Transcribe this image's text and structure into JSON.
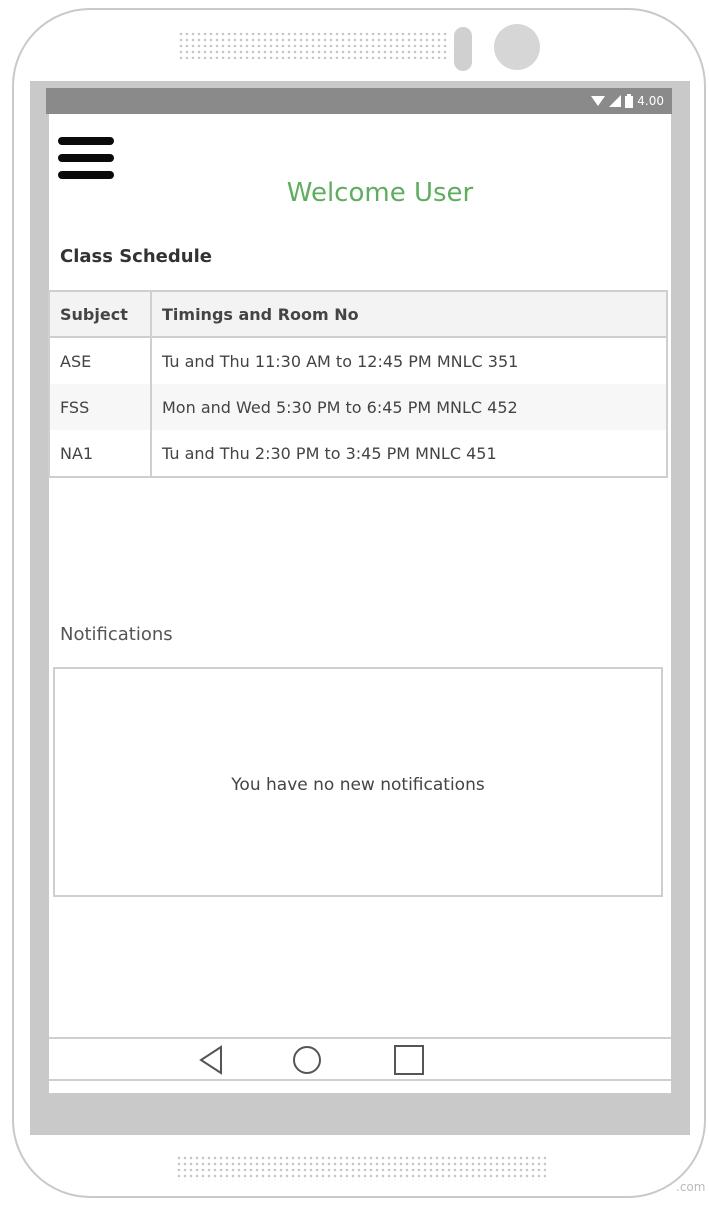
{
  "status_bar": {
    "time": "4.00"
  },
  "header": {
    "welcome": "Welcome User"
  },
  "schedule": {
    "title": "Class Schedule",
    "columns": [
      "Subject",
      "Timings and Room No"
    ],
    "rows": [
      {
        "subject": "ASE",
        "timing": "Tu and Thu 11:30 AM to 12:45 PM MNLC 351"
      },
      {
        "subject": "FSS",
        "timing": "Mon and Wed 5:30 PM to 6:45 PM MNLC 452"
      },
      {
        "subject": "NA1",
        "timing": "Tu and Thu 2:30 PM to 3:45 PM MNLC 451"
      }
    ]
  },
  "notifications": {
    "title": "Notifications",
    "empty_message": "You have no new notifications"
  },
  "nav": {
    "back_icon": "back-triangle-icon",
    "home_icon": "home-circle-icon",
    "recent_icon": "recent-square-icon"
  },
  "watermark": ".com",
  "colors": {
    "welcome": "#5fae5f",
    "status_bar": "#8a8a8a",
    "border": "#cfcfcf"
  }
}
